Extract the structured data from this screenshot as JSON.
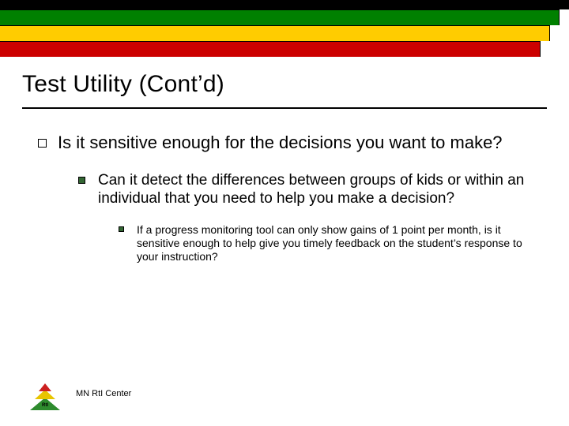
{
  "header": {
    "bar_colors": {
      "green": "#008000",
      "yellow": "#ffcc00",
      "red": "#cc0000"
    }
  },
  "slide": {
    "title": "Test Utility (Cont’d)",
    "lvl1_text": "Is it sensitive enough for the decisions you want to make?",
    "lvl2_text": "Can it detect the differences between groups of kids or within an individual that you need to help you make a decision?",
    "lvl3_text": "If a progress monitoring tool can only show gains of 1 point per month, is it sensitive enough to help give you timely feedback on the student’s response to your instruction?"
  },
  "footer": {
    "logo_label": "RtI",
    "text": "MN RtI Center"
  }
}
